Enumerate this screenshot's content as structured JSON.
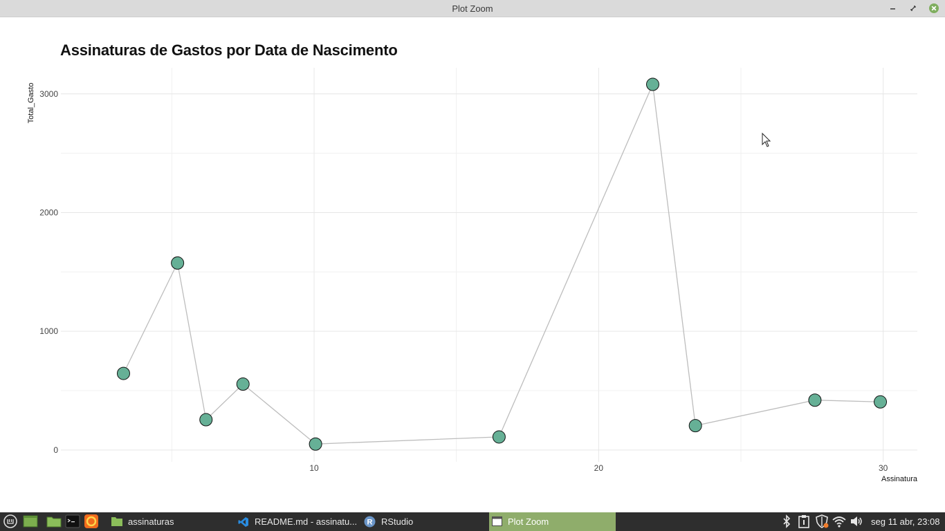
{
  "window": {
    "title": "Plot Zoom"
  },
  "chart_data": {
    "type": "line",
    "title": "Assinaturas de Gastos por Data de Nascimento",
    "xlabel": "Assinatura",
    "ylabel": "Total_Gasto",
    "x_ticks": [
      10,
      20,
      30
    ],
    "y_ticks": [
      0,
      1000,
      2000,
      3000
    ],
    "xlim": [
      1.1,
      31.2
    ],
    "ylim": [
      -100,
      3220
    ],
    "grid": true,
    "series": [
      {
        "x": [
          3.3,
          5.2,
          6.2,
          7.5,
          10.05,
          16.5,
          21.9,
          23.4,
          27.6,
          29.9
        ],
        "y": [
          645,
          1575,
          255,
          555,
          50,
          110,
          3080,
          205,
          420,
          405
        ],
        "marker_color": "#66b096",
        "line_color": "#bdbdbd"
      }
    ]
  },
  "cursor": "arrow-cursor",
  "taskbar": {
    "tasks": [
      {
        "label": "assinaturas",
        "icon": "folder-icon"
      },
      {
        "label": "README.md - assinatu...",
        "icon": "vscode-icon"
      },
      {
        "label": "RStudio",
        "icon": "rstudio-icon"
      },
      {
        "label": "Plot Zoom",
        "icon": "window-icon",
        "active": true
      }
    ],
    "clock": "seg 11 abr, 23:08",
    "colors": {
      "bar": "#2e2e2e",
      "active_task": "#8fad6b"
    }
  }
}
